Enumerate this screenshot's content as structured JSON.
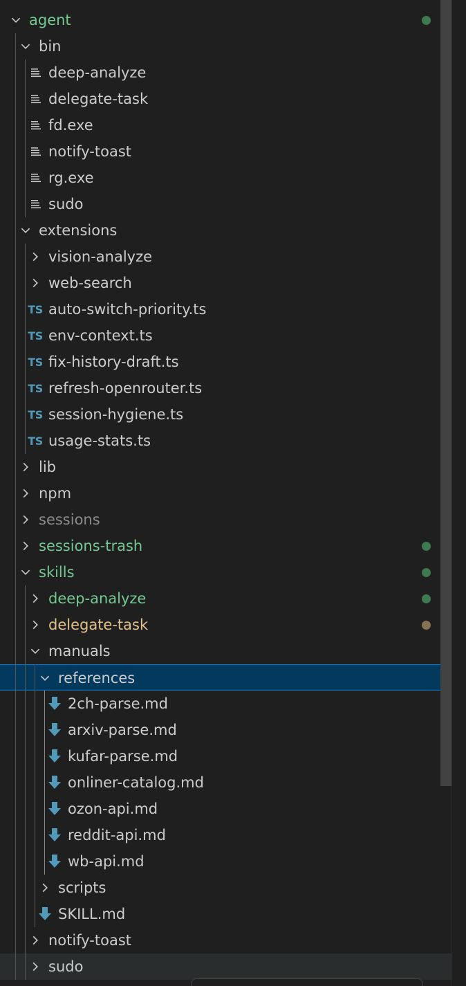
{
  "colors": {
    "text_default": "#cccccc",
    "text_dimmed": "#8b8b8b",
    "git_untracked": "#73c991",
    "git_modified": "#e2c08d",
    "badge_untracked": "#3e7a4f",
    "badge_modified": "#857253",
    "ts_icon": "#519aba",
    "markdown_icon": "#519aba",
    "selection": "#04395e"
  },
  "tree": [
    {
      "label": "agent",
      "type": "folder",
      "expanded": true,
      "git": "untracked",
      "badge": true
    },
    {
      "label": "bin",
      "type": "folder",
      "expanded": true
    },
    {
      "label": "deep-analyze",
      "type": "file",
      "icon": "file-lines-icon"
    },
    {
      "label": "delegate-task",
      "type": "file",
      "icon": "file-lines-icon"
    },
    {
      "label": "fd.exe",
      "type": "file",
      "icon": "file-lines-icon"
    },
    {
      "label": "notify-toast",
      "type": "file",
      "icon": "file-lines-icon"
    },
    {
      "label": "rg.exe",
      "type": "file",
      "icon": "file-lines-icon"
    },
    {
      "label": "sudo",
      "type": "file",
      "icon": "file-lines-icon"
    },
    {
      "label": "extensions",
      "type": "folder",
      "expanded": true
    },
    {
      "label": "vision-analyze",
      "type": "folder",
      "expanded": false
    },
    {
      "label": "web-search",
      "type": "folder",
      "expanded": false
    },
    {
      "label": "auto-switch-priority.ts",
      "type": "file",
      "icon": "typescript-icon",
      "icon_text": "TS"
    },
    {
      "label": "env-context.ts",
      "type": "file",
      "icon": "typescript-icon",
      "icon_text": "TS"
    },
    {
      "label": "fix-history-draft.ts",
      "type": "file",
      "icon": "typescript-icon",
      "icon_text": "TS"
    },
    {
      "label": "refresh-openrouter.ts",
      "type": "file",
      "icon": "typescript-icon",
      "icon_text": "TS"
    },
    {
      "label": "session-hygiene.ts",
      "type": "file",
      "icon": "typescript-icon",
      "icon_text": "TS"
    },
    {
      "label": "usage-stats.ts",
      "type": "file",
      "icon": "typescript-icon",
      "icon_text": "TS"
    },
    {
      "label": "lib",
      "type": "folder",
      "expanded": false
    },
    {
      "label": "npm",
      "type": "folder",
      "expanded": false
    },
    {
      "label": "sessions",
      "type": "folder",
      "expanded": false,
      "git": "ignored"
    },
    {
      "label": "sessions-trash",
      "type": "folder",
      "expanded": false,
      "git": "untracked",
      "badge": true
    },
    {
      "label": "skills",
      "type": "folder",
      "expanded": true,
      "git": "untracked",
      "badge": true
    },
    {
      "label": "deep-analyze",
      "type": "folder",
      "expanded": false,
      "git": "untracked",
      "badge": true
    },
    {
      "label": "delegate-task",
      "type": "folder",
      "expanded": false,
      "git": "modified",
      "badge": true
    },
    {
      "label": "manuals",
      "type": "folder",
      "expanded": true
    },
    {
      "label": "references",
      "type": "folder",
      "expanded": true,
      "selected": true
    },
    {
      "label": "2ch-parse.md",
      "type": "file",
      "icon": "markdown-icon"
    },
    {
      "label": "arxiv-parse.md",
      "type": "file",
      "icon": "markdown-icon"
    },
    {
      "label": "kufar-parse.md",
      "type": "file",
      "icon": "markdown-icon"
    },
    {
      "label": "onliner-catalog.md",
      "type": "file",
      "icon": "markdown-icon"
    },
    {
      "label": "ozon-api.md",
      "type": "file",
      "icon": "markdown-icon"
    },
    {
      "label": "reddit-api.md",
      "type": "file",
      "icon": "markdown-icon"
    },
    {
      "label": "wb-api.md",
      "type": "file",
      "icon": "markdown-icon"
    },
    {
      "label": "scripts",
      "type": "folder",
      "expanded": false
    },
    {
      "label": "SKILL.md",
      "type": "file",
      "icon": "markdown-icon"
    },
    {
      "label": "notify-toast",
      "type": "folder",
      "expanded": false
    },
    {
      "label": "sudo",
      "type": "folder",
      "expanded": false,
      "hover": true
    }
  ]
}
